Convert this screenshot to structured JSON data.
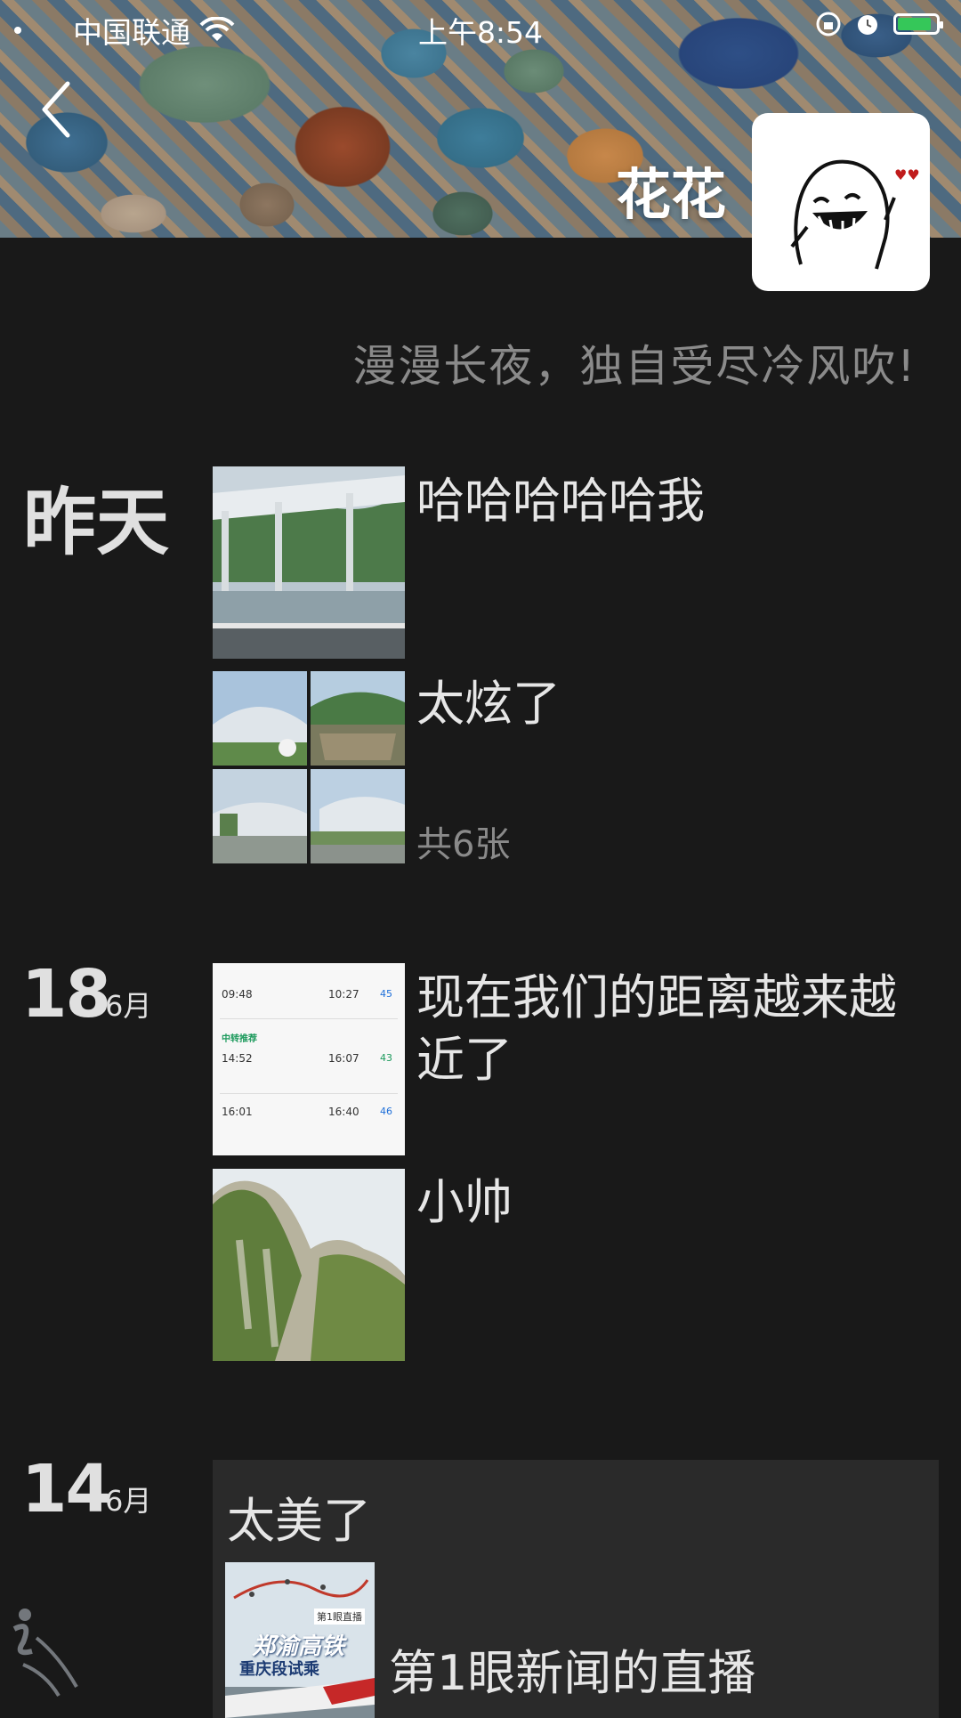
{
  "status_bar": {
    "carrier": "中国联通",
    "time": "上午8:54"
  },
  "profile": {
    "name": "花花",
    "signature": "漫漫长夜，独自受尽冷风吹!"
  },
  "posts": [
    {
      "date_label": "昨天",
      "text": "哈哈哈哈哈我",
      "image": "station-platform-photo"
    },
    {
      "text": "太炫了",
      "photo_count": "共6张",
      "image": "station-photo-grid"
    },
    {
      "date_day": "18",
      "date_month": "6月",
      "text": "现在我们的距离越来越近了",
      "image": "train-ticket-screenshot"
    },
    {
      "text": "小帅",
      "image": "mountain-cliff-photo"
    },
    {
      "date_day": "14",
      "date_month": "6月",
      "text": "太美了",
      "shared_link": {
        "title": "第1眼新闻的直播",
        "thumb_lines": [
          "郑渝高铁",
          "重庆段试乘"
        ],
        "thumb_badge": "第1眼直播"
      }
    }
  ],
  "ticket": {
    "rows": [
      {
        "dep": "09:48",
        "arr": "10:27",
        "tag": "45"
      },
      {
        "dep": "14:52",
        "arr": "16:07",
        "tag": "43"
      },
      {
        "dep": "16:01",
        "arr": "16:40",
        "tag": "46"
      }
    ],
    "label": "中转推荐"
  },
  "colors": {
    "background": "#191919",
    "text": "#e6e6e6",
    "secondary": "#8a8a8a",
    "card": "#2a2a2a"
  }
}
